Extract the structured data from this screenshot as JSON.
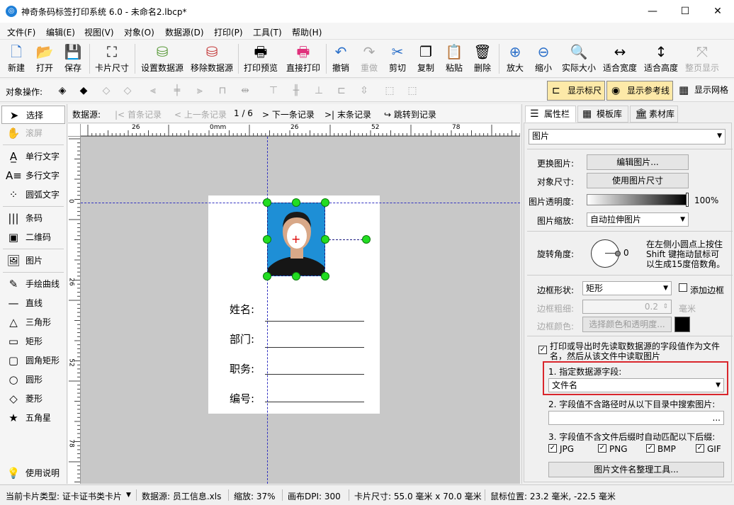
{
  "window": {
    "title": "神奇条码标签打印系统 6.0 - 未命名2.lbcp*",
    "min_label": "—",
    "max_label": "☐",
    "close_label": "✕"
  },
  "menu": [
    "文件(F)",
    "编辑(E)",
    "视图(V)",
    "对象(O)",
    "数据源(D)",
    "打印(P)",
    "工具(T)",
    "帮助(H)"
  ],
  "toolbar": {
    "new": "新建",
    "open": "打开",
    "save": "保存",
    "card_size": "卡片尺寸",
    "set_datasource": "设置数据源",
    "remove_datasource": "移除数据源",
    "print_preview": "打印预览",
    "direct_print": "直接打印",
    "undo": "撤销",
    "redo": "重做",
    "cut": "剪切",
    "copy": "复制",
    "paste": "粘贴",
    "delete": "删除",
    "zoom_in": "放大",
    "zoom_out": "缩小",
    "actual_size": "实际大小",
    "fit_width": "适合宽度",
    "fit_height": "适合高度",
    "full_page": "整页显示"
  },
  "objbar": {
    "label": "对象操作:",
    "show_ruler": "显示标尺",
    "show_guides": "显示参考线",
    "show_grid": "显示网格"
  },
  "tools": {
    "select": "选择",
    "scroll": "滚屏",
    "single_text": "单行文字",
    "multi_text": "多行文字",
    "arc_text": "圆弧文字",
    "barcode": "条码",
    "qrcode": "二维码",
    "image": "图片",
    "freehand": "手绘曲线",
    "line": "直线",
    "triangle": "三角形",
    "rectangle": "矩形",
    "round_rect": "圆角矩形",
    "circle": "圆形",
    "diamond": "菱形",
    "star": "五角星",
    "help": "使用说明"
  },
  "nav": {
    "label": "数据源:",
    "first": "首条记录",
    "prev": "上一条记录",
    "position": "1 / 6",
    "next": "下一条记录",
    "last": "末条记录",
    "jump": "跳转到记录"
  },
  "ruler": {
    "top_ticks": [
      "26",
      "0mm",
      "26",
      "52",
      "78"
    ],
    "left_ticks": [
      "0",
      "26",
      "52",
      "78"
    ]
  },
  "card": {
    "fields": [
      "姓名:",
      "部门:",
      "职务:",
      "编号:"
    ]
  },
  "panel": {
    "tabs": [
      "属性栏",
      "模板库",
      "素材库"
    ],
    "object_type": "图片",
    "change_image_label": "更换图片:",
    "edit_image": "编辑图片...",
    "object_size_label": "对象尺寸:",
    "use_image_size": "使用图片尺寸",
    "opacity_label": "图片透明度:",
    "opacity_value": "100%",
    "scale_label": "图片缩放:",
    "scale_value": "自动拉伸图片",
    "rotation_label": "旋转角度:",
    "rotation_value": "0",
    "rotation_hint_1": "在左侧小圆点上按住",
    "rotation_hint_2": "Shift 键拖动鼠标可",
    "rotation_hint_3": "以生成15度倍数角。",
    "border_shape_label": "边框形状:",
    "border_shape_value": "矩形",
    "add_border": "添加边框",
    "border_width_label": "边框粗细:",
    "border_width_value": "0.2",
    "border_width_unit": "毫米",
    "border_color_label": "边框颜色:",
    "border_color_btn": "选择颜色和透明度...",
    "read_from_datasource_1": "打印或导出时先读取数据源的字段值作为文件",
    "read_from_datasource_2": "名，然后从该文件中读取图片",
    "step1": "1. 指定数据源字段:",
    "field_value": "文件名",
    "step2": "2. 字段值不含路径时从以下目录中搜索图片:",
    "dir_btn": "...",
    "step3": "3. 字段值不含文件后缀时自动匹配以下后缀:",
    "exts": [
      "JPG",
      "PNG",
      "BMP",
      "GIF"
    ],
    "tool_btn": "图片文件名整理工具..."
  },
  "status": {
    "card_type": "当前卡片类型: 证卡证书类卡片",
    "datasource": "数据源: 员工信息.xls",
    "zoom": "缩放: 37%",
    "dpi": "画布DPI: 300",
    "card_size": "卡片尺寸: 55.0 毫米 x 70.0 毫米",
    "mouse": "鼠标位置: 23.2 毫米, -22.5 毫米"
  },
  "colors": {
    "accent": "#1e7fd8",
    "highlight_box": "#d9262c",
    "handle": "#22dd22",
    "toggle_bg": "#fde9a8",
    "photo_bg": "#1e8fd6"
  }
}
